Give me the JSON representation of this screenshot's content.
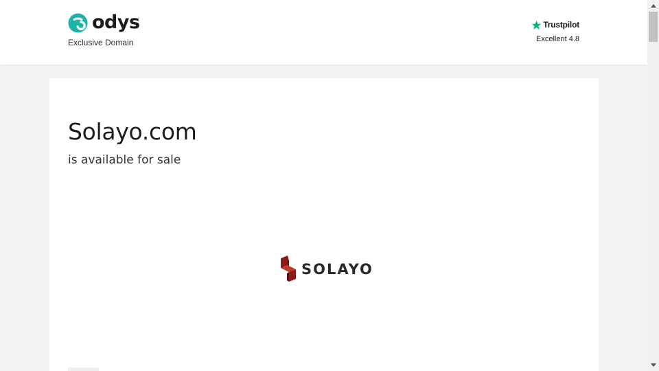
{
  "header": {
    "brand_name": "odys",
    "brand_tagline": "Exclusive Domain",
    "trustpilot": {
      "name": "Trustpilot",
      "rating_text": "Excellent 4.8",
      "star_color": "#00b67a"
    }
  },
  "main": {
    "domain": "Solayo.com",
    "availability": "is available for sale",
    "logo_text": "SOLAYO",
    "logo_colors": [
      "#8b1a1a",
      "#c0392b",
      "#5a0f0f"
    ]
  },
  "colors": {
    "brand_teal": "#1cb3a6",
    "page_bg": "#f3f3f3"
  },
  "icons": {
    "brand_mark": "odys-logo-icon",
    "trust_star": "star-icon",
    "domain_mark": "solayo-logo-icon",
    "scroll_up": "chevron-up-icon",
    "scroll_down": "chevron-down-icon"
  }
}
